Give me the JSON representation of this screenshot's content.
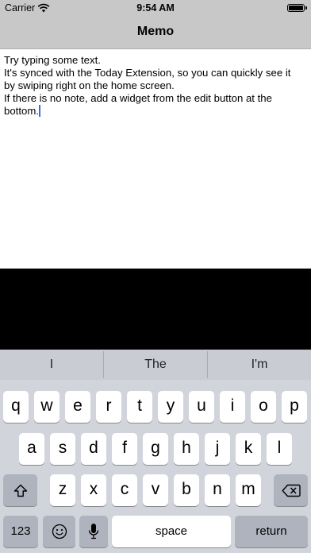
{
  "status_bar": {
    "carrier": "Carrier",
    "time": "9:54 AM",
    "wifi_icon": "wifi-icon",
    "battery_icon": "battery-icon",
    "battery_level": 1.0
  },
  "nav_bar": {
    "title": "Memo"
  },
  "memo": {
    "lines": [
      "Try typing some text.",
      "It's synced with the Today Extension, so you can quickly see it",
      "by swiping right on the home screen.",
      "If there is no note, add a widget from the edit button at the",
      "bottom."
    ]
  },
  "keyboard": {
    "suggestions": [
      "I",
      "The",
      "I'm"
    ],
    "row1": [
      "q",
      "w",
      "e",
      "r",
      "t",
      "y",
      "u",
      "i",
      "o",
      "p"
    ],
    "row2": [
      "a",
      "s",
      "d",
      "f",
      "g",
      "h",
      "j",
      "k",
      "l"
    ],
    "row3": [
      "z",
      "x",
      "c",
      "v",
      "b",
      "n",
      "m"
    ],
    "shift_icon": "shift-icon",
    "delete_icon": "delete-icon",
    "numbers_label": "123",
    "emoji_icon": "emoji-icon",
    "mic_icon": "microphone-icon",
    "space_label": "space",
    "return_label": "return"
  }
}
